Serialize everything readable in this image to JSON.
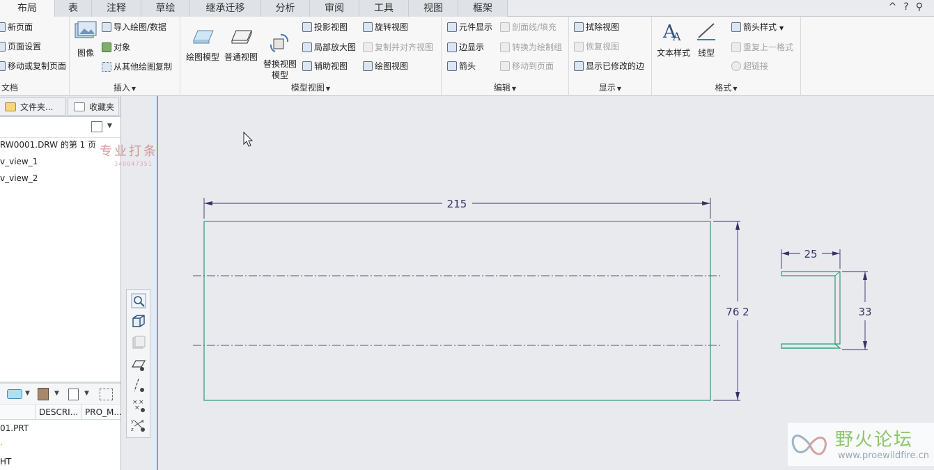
{
  "tabs": [
    "布局",
    "表",
    "注释",
    "草绘",
    "继承迁移",
    "分析",
    "审阅",
    "工具",
    "视图",
    "框架"
  ],
  "active_tab": "布局",
  "window_controls": [
    "^",
    "?",
    "⚲"
  ],
  "ribbon": {
    "doc": {
      "label": "文档",
      "items": [
        "新页面",
        "页面设置",
        "移动或复制页面"
      ]
    },
    "insert": {
      "label": "插入",
      "big": "图像",
      "items": [
        "导入绘图/数据",
        "对象",
        "从其他绘图复制"
      ]
    },
    "model_view": {
      "label": "模型视图",
      "big": [
        "绘图模型",
        "普通视图",
        "替换视图\n模型"
      ],
      "col1": [
        "投影视图",
        "局部放大图",
        "辅助视图"
      ],
      "col2": [
        "旋转视图",
        "复制并对齐视图",
        "绘图视图"
      ]
    },
    "edit": {
      "label": "编辑",
      "col1": [
        "元件显示",
        "边显示",
        "箭头"
      ],
      "col2": [
        "剖面线/填充",
        "转换为绘制组",
        "移动到页面"
      ]
    },
    "display": {
      "label": "显示",
      "items": [
        "拭除视图",
        "恢复视图",
        "显示已修改的边"
      ]
    },
    "format": {
      "label": "格式",
      "big": [
        "文本样式",
        "线型"
      ],
      "items": [
        "箭头样式",
        "重复上一格式",
        "超链接"
      ]
    }
  },
  "left_panel": {
    "tabs": [
      "文件夹...",
      "收藏夹"
    ],
    "tree": [
      "RW0001.DRW 的第 1 页",
      "v_view_1",
      "v_view_2"
    ],
    "columns": [
      "DESCRI...",
      "PRO_M..."
    ],
    "parts": [
      "01.PRT",
      "",
      "HT"
    ]
  },
  "watermark_left": {
    "title": "专业打条",
    "sub": "340047351"
  },
  "drawing": {
    "dim_width": "215",
    "dim_height": "76 2",
    "dim_flange": "25",
    "dim_section_height": "33"
  },
  "watermark_right": {
    "title": "野火论坛",
    "url": "www.proewildfire.cn"
  }
}
